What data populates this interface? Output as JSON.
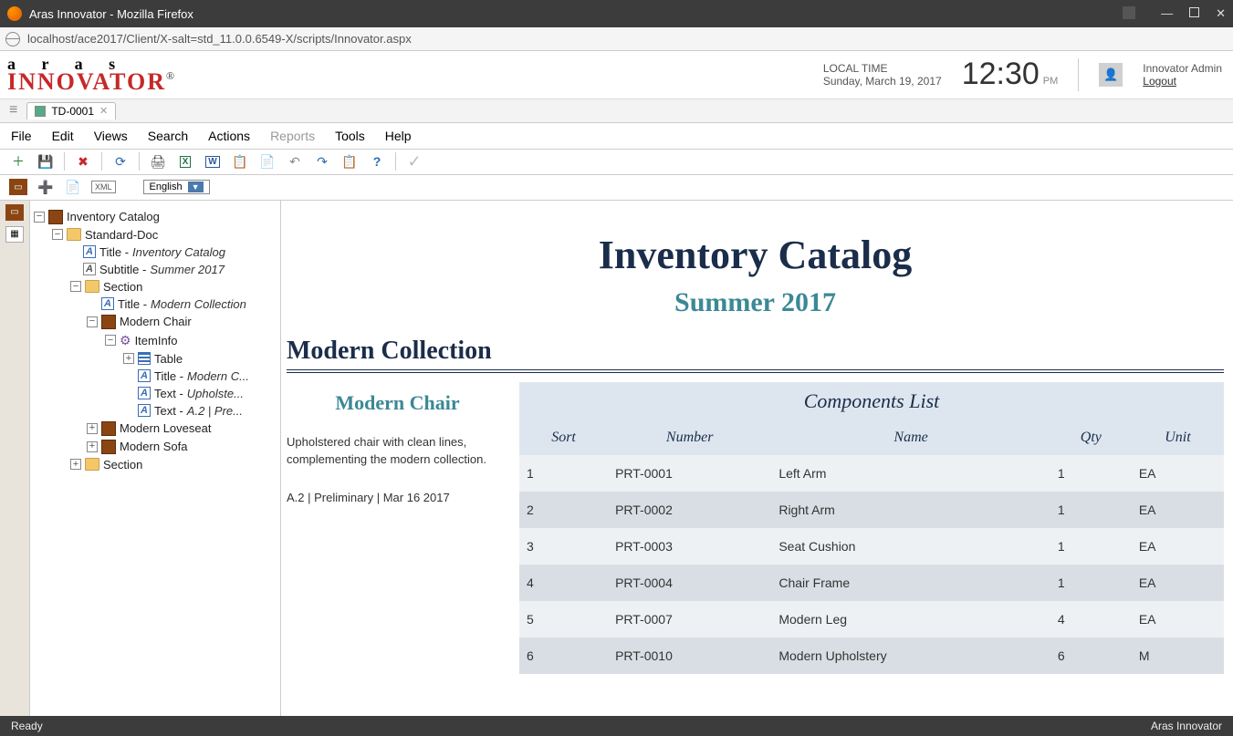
{
  "window": {
    "title": "Aras Innovator - Mozilla Firefox"
  },
  "address": {
    "url": "localhost/ace2017/Client/X-salt=std_11.0.0.6549-X/scripts/Innovator.aspx"
  },
  "brand": {
    "l1": "a r a s",
    "l2": "INNOVATOR"
  },
  "localtime": {
    "label": "LOCAL TIME",
    "date": "Sunday, March 19, 2017",
    "time": "12:30",
    "ampm": "PM"
  },
  "user": {
    "name": "Innovator Admin",
    "logout": "Logout"
  },
  "tabs": {
    "open": "TD-0001"
  },
  "menus": {
    "file": "File",
    "edit": "Edit",
    "views": "Views",
    "search": "Search",
    "actions": "Actions",
    "reports": "Reports",
    "tools": "Tools",
    "help": "Help"
  },
  "toolbar2": {
    "lang": "English"
  },
  "tree": {
    "root": "Inventory Catalog",
    "std": "Standard-Doc",
    "title": {
      "pre": "Title - ",
      "val": "Inventory Catalog"
    },
    "subtitle": {
      "pre": "Subtitle - ",
      "val": "Summer 2017"
    },
    "section1": "Section",
    "s1title": {
      "pre": "Title - ",
      "val": "Modern Collection"
    },
    "chair": "Modern Chair",
    "iteminfo": "ItemInfo",
    "table": "Table",
    "chTitle": {
      "pre": "Title - ",
      "val": "Modern C..."
    },
    "chText1": {
      "pre": "Text - ",
      "val": "Upholste..."
    },
    "chText2": {
      "pre": "Text - ",
      "val": "A.2 | Pre..."
    },
    "love": "Modern Loveseat",
    "sofa": "Modern Sofa",
    "section2": "Section"
  },
  "doc": {
    "title": "Inventory Catalog",
    "subtitle": "Summer 2017",
    "section": "Modern Collection",
    "item": {
      "name": "Modern Chair",
      "desc": "Upholstered chair with clean lines, complementing the modern collection.",
      "meta": "A.2  |  Preliminary  |  Mar 16 2017"
    },
    "tableTitle": "Components List",
    "headers": {
      "sort": "Sort",
      "number": "Number",
      "name": "Name",
      "qty": "Qty",
      "unit": "Unit"
    },
    "rows": [
      {
        "sort": "1",
        "number": "PRT-0001",
        "name": "Left Arm",
        "qty": "1",
        "unit": "EA"
      },
      {
        "sort": "2",
        "number": "PRT-0002",
        "name": "Right Arm",
        "qty": "1",
        "unit": "EA"
      },
      {
        "sort": "3",
        "number": "PRT-0003",
        "name": "Seat Cushion",
        "qty": "1",
        "unit": "EA"
      },
      {
        "sort": "4",
        "number": "PRT-0004",
        "name": "Chair Frame",
        "qty": "1",
        "unit": "EA"
      },
      {
        "sort": "5",
        "number": "PRT-0007",
        "name": "Modern Leg",
        "qty": "4",
        "unit": "EA"
      },
      {
        "sort": "6",
        "number": "PRT-0010",
        "name": "Modern Upholstery",
        "qty": "6",
        "unit": "M"
      }
    ]
  },
  "status": {
    "left": "Ready",
    "right": "Aras Innovator"
  }
}
